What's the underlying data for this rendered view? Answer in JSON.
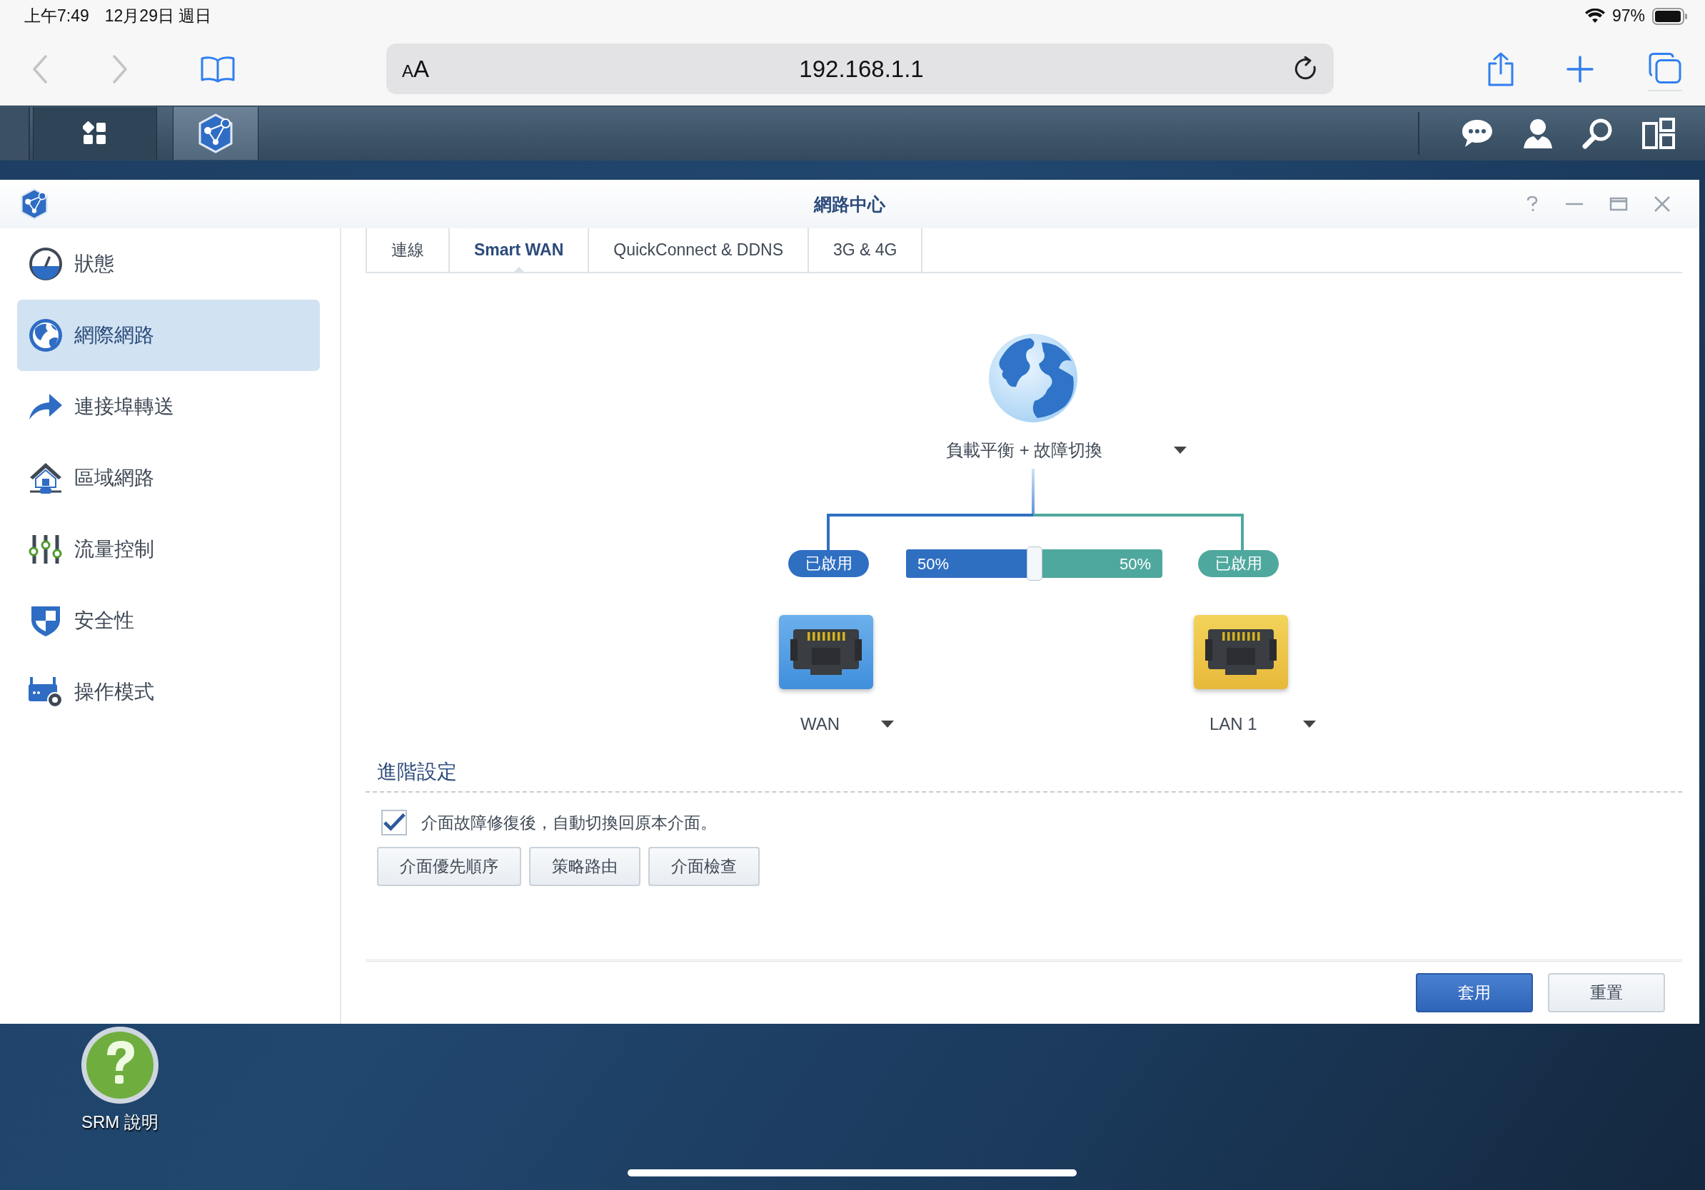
{
  "status_bar": {
    "time": "上午7:49",
    "date": "12月29日 週日",
    "battery": "97%"
  },
  "browser": {
    "text_size": "AA",
    "url": "192.168.1.1"
  },
  "taskbar": {
    "apps": [
      {
        "kind": "main-menu",
        "selected": false
      },
      {
        "kind": "network-center",
        "selected": true
      }
    ]
  },
  "window": {
    "title": "網路中心"
  },
  "sidebar": {
    "items": [
      {
        "kind": "gauge",
        "label": "狀態",
        "selected": false
      },
      {
        "kind": "globe",
        "label": "網際網路",
        "selected": true
      },
      {
        "kind": "forward",
        "label": "連接埠轉送",
        "selected": false
      },
      {
        "kind": "home",
        "label": "區域網路",
        "selected": false
      },
      {
        "kind": "sliders",
        "label": "流量控制",
        "selected": false
      },
      {
        "kind": "shield",
        "label": "安全性",
        "selected": false
      },
      {
        "kind": "router",
        "label": "操作模式",
        "selected": false
      }
    ]
  },
  "tabs": [
    {
      "label": "連線",
      "selected": false
    },
    {
      "label": "Smart WAN",
      "selected": true
    },
    {
      "label": "QuickConnect & DDNS",
      "selected": false
    },
    {
      "label": "3G & 4G",
      "selected": false
    }
  ],
  "smart_wan": {
    "mode": "負載平衡 + 故障切換",
    "interfaces": [
      {
        "kind": "wan",
        "name": "WAN",
        "status": "已啟用",
        "color": "#2f6fc2"
      },
      {
        "kind": "lan",
        "name": "LAN 1",
        "status": "已啟用",
        "color": "#4fa89e"
      }
    ],
    "balance": {
      "level": 0.5,
      "left_reading": "50%",
      "right_reading": "50%"
    }
  },
  "advanced": {
    "title": "進階設定",
    "auto_failback": {
      "label": "介面故障修復後，自動切換回原本介面。",
      "checked": true
    },
    "buttons": [
      "介面優先順序",
      "策略路由",
      "介面檢查"
    ]
  },
  "footer_buttons": [
    {
      "kind": "primary",
      "label": "套用"
    },
    {
      "kind": "secondary",
      "label": "重置"
    }
  ],
  "desktop": {
    "shortcuts": [
      {
        "label": "SRM 說明"
      }
    ]
  }
}
